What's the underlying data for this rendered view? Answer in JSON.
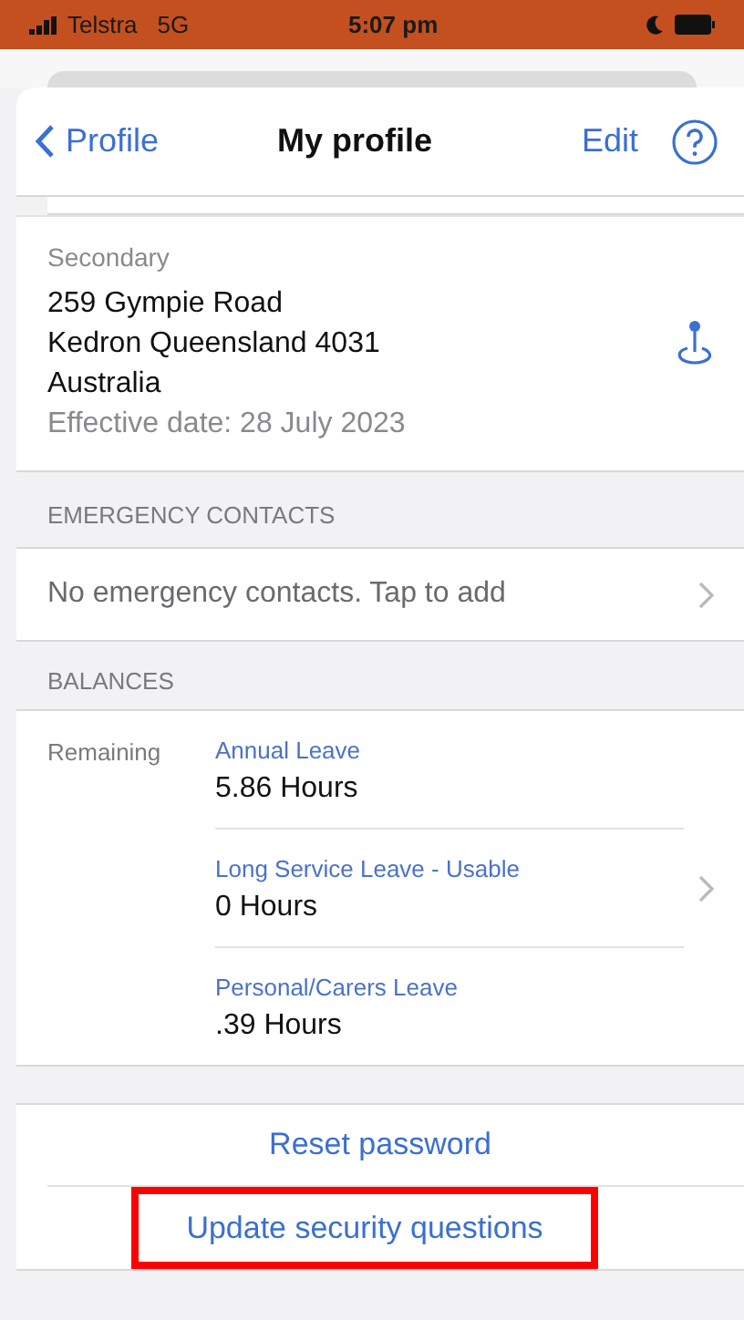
{
  "status_bar": {
    "carrier": "Telstra",
    "network": "5G",
    "time": "5:07 pm"
  },
  "nav": {
    "back": "Profile",
    "title": "My profile",
    "edit": "Edit"
  },
  "address": {
    "label": "Secondary",
    "lines": [
      "259 Gympie Road",
      "Kedron Queensland 4031",
      "Australia"
    ],
    "effective": "Effective date: 28 July 2023"
  },
  "emergency": {
    "header": "EMERGENCY CONTACTS",
    "row": "No emergency contacts. Tap to add"
  },
  "balances": {
    "header": "BALANCES",
    "label": "Remaining",
    "items": [
      {
        "name": "Annual Leave",
        "value": "5.86 Hours"
      },
      {
        "name": "Long Service Leave - Usable",
        "value": "0 Hours"
      },
      {
        "name": "Personal/Carers Leave",
        "value": ".39 Hours"
      }
    ]
  },
  "actions": [
    {
      "label": "Reset password",
      "highlighted": false
    },
    {
      "label": "Update security questions",
      "highlighted": true
    }
  ]
}
